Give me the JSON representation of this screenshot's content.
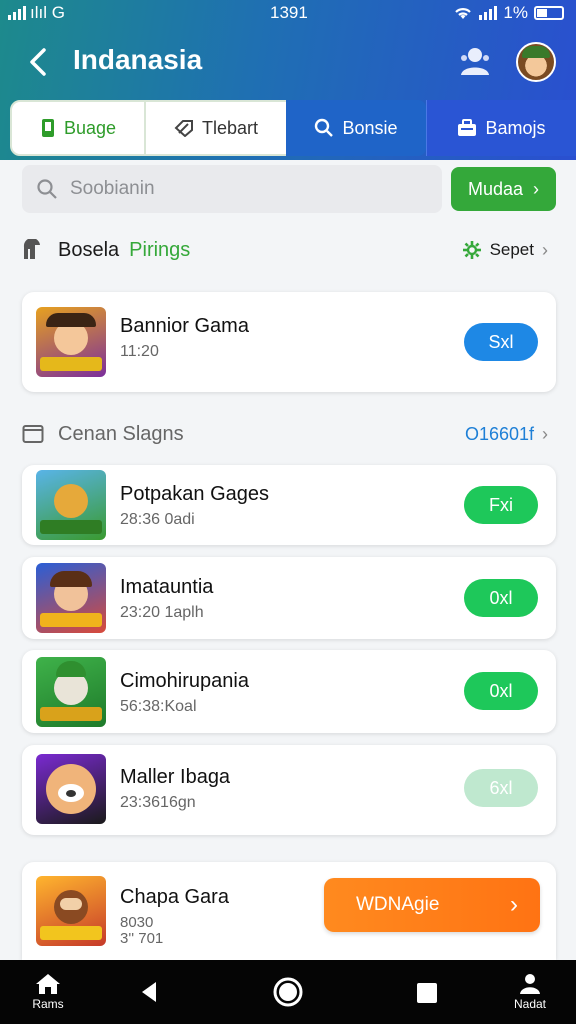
{
  "status_bar": {
    "carrier": "ılıl G",
    "time": "1391",
    "battery": "1%"
  },
  "header": {
    "title": "Indanasia"
  },
  "tabs": [
    {
      "label": "Buage",
      "icon": "phone-icon"
    },
    {
      "label": "Tlebart",
      "icon": "tag-icon"
    },
    {
      "label": "Bonsie",
      "icon": "search-icon"
    },
    {
      "label": "Bamojs",
      "icon": "briefcase-icon"
    }
  ],
  "search": {
    "placeholder": "Soobianin",
    "button_label": "Mudaa"
  },
  "section1": {
    "label": "Bosela",
    "accent": "Pirings",
    "right_label": "Sepet"
  },
  "featured": {
    "name": "Bannior Gama",
    "meta": "11:20",
    "button": "Sxl"
  },
  "section2": {
    "label": "Cenan Slagns",
    "right_label": "O16601f"
  },
  "items": [
    {
      "name": "Potpakan Gages",
      "meta": "28:36 0adi",
      "button": "Fxi"
    },
    {
      "name": "Imatauntia",
      "meta": "23:20 1aplh",
      "button": "0xl"
    },
    {
      "name": "Cimohirupania",
      "meta": "56:38:Koal",
      "button": "0xl"
    },
    {
      "name": "Maller Ibaga",
      "meta": "23:3616gn",
      "button": "6xl"
    }
  ],
  "bottom_card": {
    "name": "Chapa Gara",
    "meta1": "8030",
    "meta2": "3'' 701",
    "button": "WDNAgie"
  },
  "navbar": {
    "home_label": "Rams",
    "profile_label": "Nadat"
  },
  "colors": {
    "green": "#34a83a",
    "blue": "#1e88e5",
    "orange": "#ff7a17",
    "header_start": "#1d8a8c",
    "header_end": "#2a4fd0"
  }
}
